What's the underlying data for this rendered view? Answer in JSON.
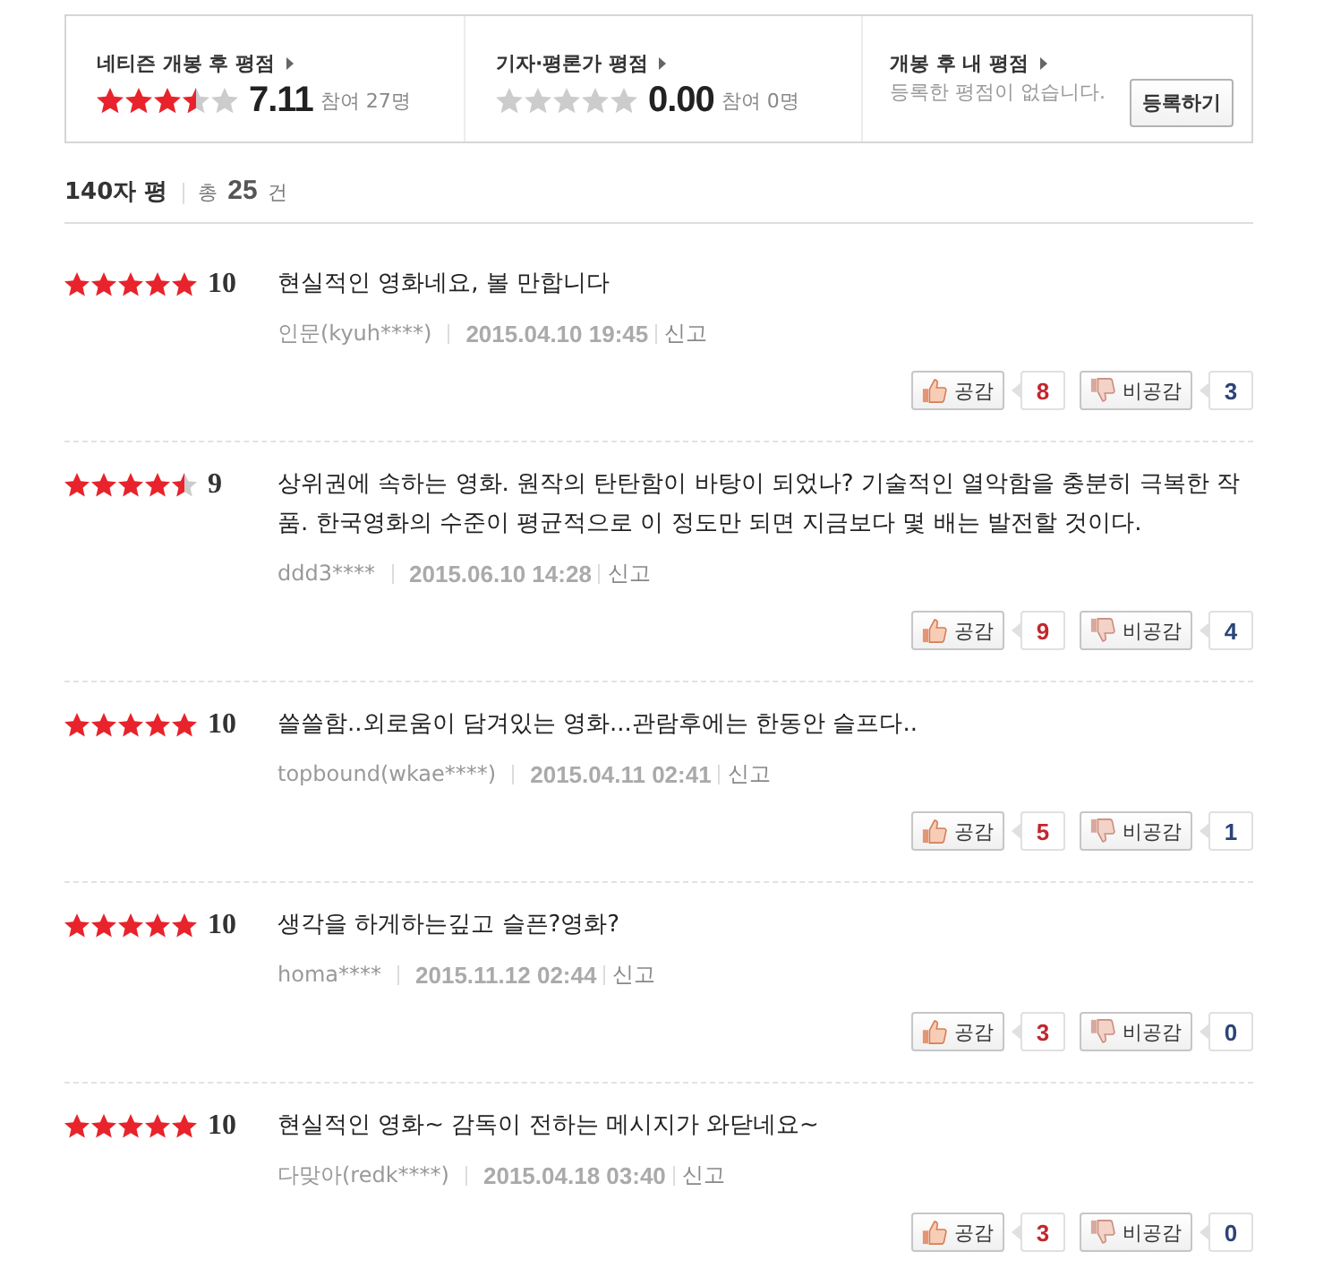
{
  "summary": [
    {
      "kind": "score",
      "title": "네티즌 개봉 후 평점",
      "stars": 3.5,
      "score": "7.11",
      "participants": "참여 27명"
    },
    {
      "kind": "score",
      "title": "기자·평론가 평점",
      "stars": 0,
      "score": "0.00",
      "participants": "참여 0명"
    },
    {
      "kind": "mine",
      "title": "개봉 후 내 평점",
      "message": "등록한 평점이 없습니다.",
      "button": "등록하기"
    }
  ],
  "review_header": {
    "title": "140자 평",
    "total": "총 **25** 건"
  },
  "reviews": [
    {
      "stars": 5,
      "score": "10",
      "text": "현실적인 영화네요, 볼 만합니다",
      "author": "인문(kyuh****)",
      "date": "2015.04.10 19:45",
      "report": "신고",
      "like_label": "공감",
      "like_count": "8",
      "dislike_label": "비공감",
      "dislike_count": "3"
    },
    {
      "stars": 4.5,
      "score": "9",
      "text": "상위권에 속하는 영화. 원작의 탄탄함이 바탕이 되었나? 기술적인 열악함을 충분히 극복한 작품. 한국영화의 수준이 평균적으로 이 정도만 되면 지금보다 몇 배는 발전할 것이다.",
      "author": "ddd3****",
      "date": "2015.06.10 14:28",
      "report": "신고",
      "like_label": "공감",
      "like_count": "9",
      "dislike_label": "비공감",
      "dislike_count": "4"
    },
    {
      "stars": 5,
      "score": "10",
      "text": "쓸쓸함..외로움이 담겨있는 영화...관람후에는 한동안 슬프다..",
      "author": "topbound(wkae****)",
      "date": "2015.04.11 02:41",
      "report": "신고",
      "like_label": "공감",
      "like_count": "5",
      "dislike_label": "비공감",
      "dislike_count": "1"
    },
    {
      "stars": 5,
      "score": "10",
      "text": "생각을 하게하는깊고 슬픈?영화?",
      "author": "homa****",
      "date": "2015.11.12 02:44",
      "report": "신고",
      "like_label": "공감",
      "like_count": "3",
      "dislike_label": "비공감",
      "dislike_count": "0"
    },
    {
      "stars": 5,
      "score": "10",
      "text": "현실적인 영화~ 감독이 전하는 메시지가 와닫네요~",
      "author": "다맞아(redk****)",
      "date": "2015.04.18 03:40",
      "report": "신고",
      "like_label": "공감",
      "like_count": "3",
      "dislike_label": "비공감",
      "dislike_count": "0"
    }
  ]
}
